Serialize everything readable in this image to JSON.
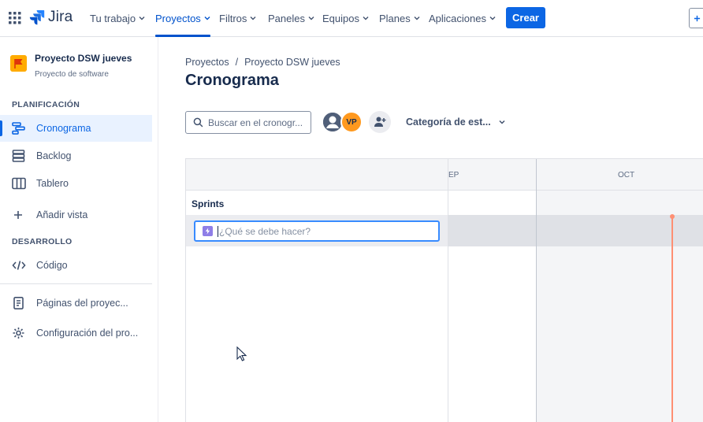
{
  "topnav": {
    "logo": "Jira",
    "items": [
      {
        "label": "Tu trabajo"
      },
      {
        "label": "Proyectos"
      },
      {
        "label": "Filtros"
      },
      {
        "label": "Paneles"
      },
      {
        "label": "Equipos"
      },
      {
        "label": "Planes"
      },
      {
        "label": "Aplicaciones"
      }
    ],
    "active_item": "Proyectos",
    "create_label": "Crear",
    "accent": "#0c66e4"
  },
  "sidebar": {
    "project_name": "Proyecto DSW jueves",
    "project_type": "Proyecto de software",
    "sections": {
      "planning": "PLANIFICACIÓN",
      "development": "DESARROLLO"
    },
    "items": [
      {
        "label": "Cronograma",
        "icon": "timeline-icon",
        "active": true
      },
      {
        "label": "Backlog",
        "icon": "backlog-icon"
      },
      {
        "label": "Tablero",
        "icon": "board-icon"
      },
      {
        "label": "Añadir vista",
        "icon": "plus-icon"
      },
      {
        "label": "Código",
        "icon": "code-icon"
      },
      {
        "label": "Páginas del proyec...",
        "icon": "page-icon"
      },
      {
        "label": "Configuración del pro...",
        "icon": "gear-icon"
      }
    ]
  },
  "main": {
    "breadcrumb": [
      "Proyectos",
      "/",
      "Proyecto DSW jueves"
    ],
    "title": "Cronograma",
    "search_placeholder": "Buscar en el cronogr...",
    "avatar_initials": "VP",
    "category_filter": "Categoría de est..."
  },
  "timeline": {
    "months": [
      "EP",
      "OCT"
    ],
    "sprints_label": "Sprints",
    "issue_placeholder": "¿Qué se debe hacer?",
    "today_color": "#ff8f73"
  }
}
